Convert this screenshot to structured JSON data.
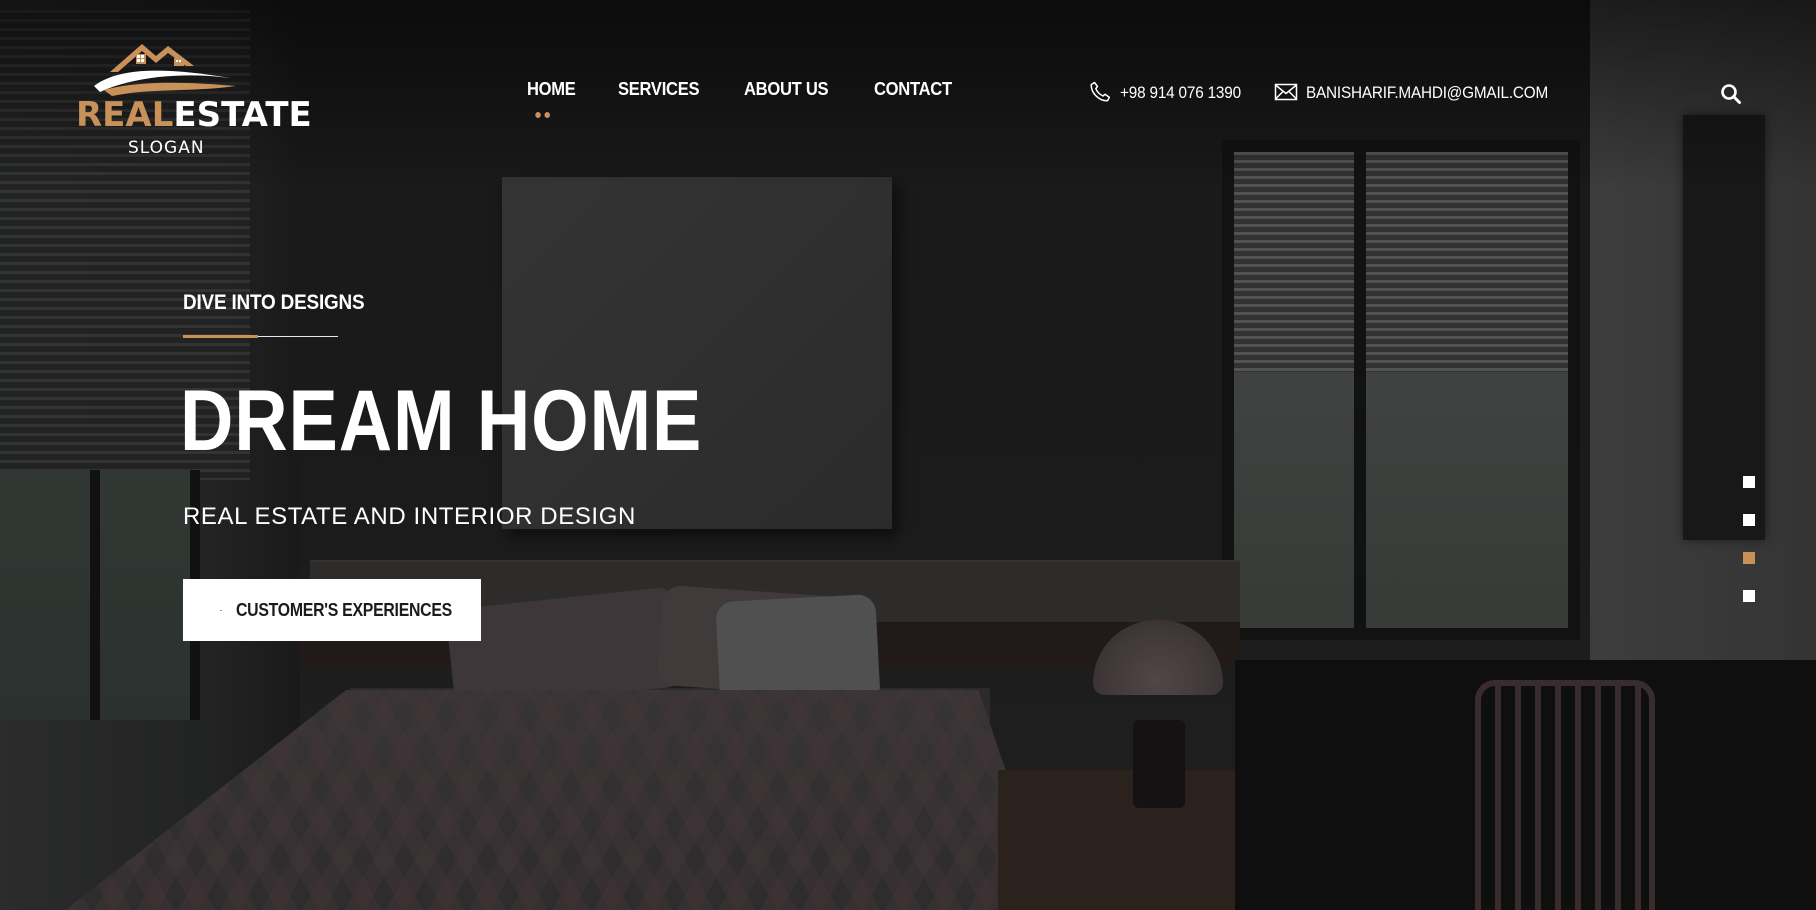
{
  "brand": {
    "logo_word1": "REAL",
    "logo_word2": "ESTATE",
    "slogan": "SLOGAN",
    "accent_color": "#c9915a"
  },
  "nav": {
    "items": [
      {
        "label": "HOME",
        "active": true
      },
      {
        "label": "SERVICES",
        "active": false
      },
      {
        "label": "ABOUT US",
        "active": false
      },
      {
        "label": "CONTACT",
        "active": false
      }
    ]
  },
  "contact": {
    "phone": "+98 914 076 1390",
    "email": "BANISHARIF.MAHDI@GMAIL.COM",
    "phone_icon": "phone-icon",
    "email_icon": "envelope-icon"
  },
  "header": {
    "search_icon": "search-icon"
  },
  "hero": {
    "kicker": "DIVE INTO DESIGNS",
    "title": "DREAM HOME",
    "subtitle": "REAL ESTATE AND INTERIOR DESIGN",
    "cta_label": "CUSTOMER'S EXPERIENCES"
  },
  "slider": {
    "total": 4,
    "active_index": 3
  }
}
